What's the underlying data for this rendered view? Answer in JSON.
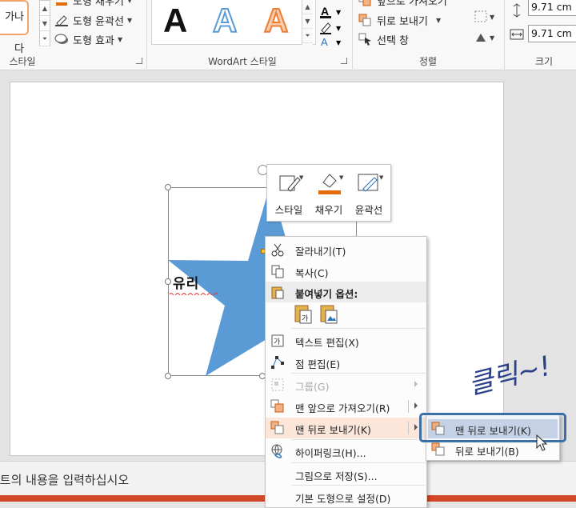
{
  "ribbon": {
    "style_swatch_text": "가나다",
    "shape_fill_label": "도형 채우기",
    "shape_outline_label": "도형 윤곽선",
    "shape_effect_label": "도형 효과",
    "shape_styles_group": "스타일",
    "wordart_letters": [
      "A",
      "A",
      "A"
    ],
    "wordart_group": "WordArt 스타일",
    "bring_forward_label": "앞으로 가져오기",
    "send_backward_label": "뒤로 보내기",
    "selection_pane_label": "선택 창",
    "arrange_group": "정렬",
    "height_value": "9.71 cm",
    "width_value": "9.71 cm",
    "size_group": "크기"
  },
  "slide": {
    "star_text": "유리",
    "notes_placeholder": "노트의 내용을 입력하십시오"
  },
  "mini_toolbar": {
    "style_label": "스타일",
    "fill_label": "채우기",
    "outline_label": "윤곽선"
  },
  "context_menu": {
    "cut": "잘라내기(T)",
    "copy": "복사(C)",
    "paste_options": "붙여넣기 옵션:",
    "edit_text": "텍스트 편집(X)",
    "edit_points": "점 편집(E)",
    "group": "그룹(G)",
    "bring_to_front": "맨 앞으로 가져오기(R)",
    "send_to_back": "맨 뒤로 보내기(K)",
    "hyperlink": "하이퍼링크(H)...",
    "save_as_picture": "그림으로 저장(S)...",
    "set_default_shape": "기본 도형으로 설정(D)"
  },
  "submenu": {
    "send_to_back": "맨 뒤로 보내기(K)",
    "send_backward": "뒤로 보내기(B)"
  },
  "annotation": "클릭~!",
  "colors": {
    "star": "#5b9bd5",
    "accent": "#d24726",
    "highlight_ring": "#3a6fa8",
    "annotation_ink": "#2a3f8a"
  }
}
